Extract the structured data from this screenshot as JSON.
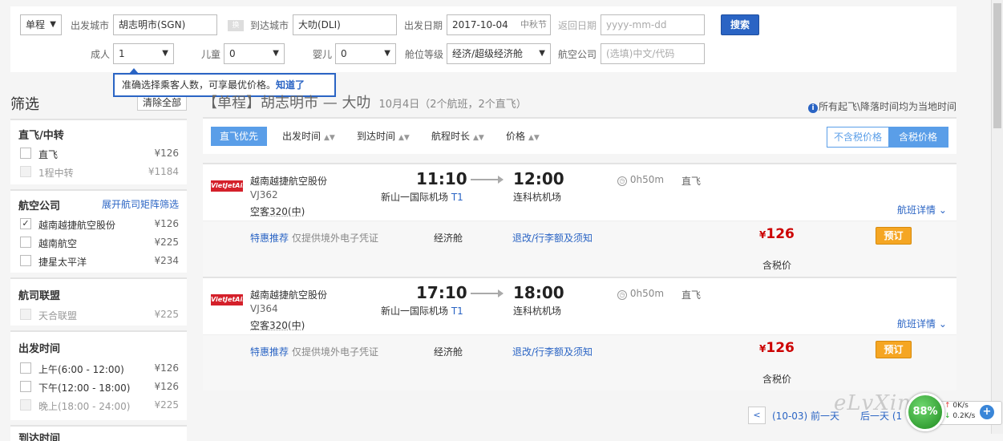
{
  "search": {
    "trip_type": "单程",
    "depart_city_label": "出发城市",
    "depart_city": "胡志明市(SGN)",
    "swap_label": "换",
    "arrive_city_label": "到达城市",
    "arrive_city": "大叻(DLI)",
    "depart_date_label": "出发日期",
    "depart_date": "2017-10-04",
    "depart_date_holiday": "中秋节",
    "return_date_label": "返回日期",
    "return_date_placeholder": "yyyy-mm-dd",
    "search_button": "搜索",
    "adult_label": "成人",
    "adult_value": "1",
    "child_label": "儿童",
    "child_value": "0",
    "infant_label": "婴儿",
    "infant_value": "0",
    "cabin_label": "舱位等级",
    "cabin_value": "经济/超级经济舱",
    "airline_label": "航空公司",
    "airline_placeholder": "(选填)中文/代码"
  },
  "tooltip": {
    "text": "准确选择乘客人数，可享最优价格。",
    "link": "知道了"
  },
  "sidebar": {
    "title": "筛选",
    "clear_all": "清除全部",
    "groups": {
      "direct": {
        "title": "直飞/中转",
        "items": [
          {
            "label": "直飞",
            "price": "¥126",
            "checked": false,
            "disabled": false
          },
          {
            "label": "1程中转",
            "price": "¥1184",
            "checked": false,
            "disabled": true
          }
        ]
      },
      "airline": {
        "title": "航空公司",
        "expand_link": "展开航司矩阵筛选",
        "items": [
          {
            "label": "越南越捷航空股份",
            "price": "¥126",
            "checked": true,
            "disabled": false
          },
          {
            "label": "越南航空",
            "price": "¥225",
            "checked": false,
            "disabled": false
          },
          {
            "label": "捷星太平洋",
            "price": "¥234",
            "checked": false,
            "disabled": false
          }
        ]
      },
      "alliance": {
        "title": "航司联盟",
        "items": [
          {
            "label": "天合联盟",
            "price": "¥225",
            "checked": false,
            "disabled": true
          }
        ]
      },
      "depart_time": {
        "title": "出发时间",
        "items": [
          {
            "label": "上午(6:00 - 12:00)",
            "price": "¥126",
            "checked": false,
            "disabled": false
          },
          {
            "label": "下午(12:00 - 18:00)",
            "price": "¥126",
            "checked": false,
            "disabled": false
          },
          {
            "label": "晚上(18:00 - 24:00)",
            "price": "¥225",
            "checked": false,
            "disabled": true
          }
        ]
      },
      "arrive_time": {
        "title": "到达时间"
      }
    }
  },
  "results": {
    "header_tag": "【单程】",
    "header_route": "胡志明市 — 大叻",
    "header_sub": "10月4日（2个航班，2个直飞）",
    "local_time_note": "所有起飞\\降落时间均为当地时间",
    "sort": {
      "direct_first": "直飞优先",
      "depart_time": "出发时间",
      "arrive_time": "到达时间",
      "duration": "航程时长",
      "price": "价格"
    },
    "tax_toggle": {
      "excl": "不含税价格",
      "incl": "含税价格"
    },
    "flights": [
      {
        "logo_text": "VietJetAir",
        "airline": "越南越捷航空股份",
        "flight_no": "VJ362",
        "aircraft": "空客320(中)",
        "depart_time": "11:10",
        "depart_airport": "新山一国际机场",
        "depart_terminal": "T1",
        "arrive_time": "12:00",
        "arrive_airport": "连科杭机场",
        "duration": "0h50m",
        "direct": "直飞",
        "detail_link": "航班详情",
        "promo": "特惠推荐",
        "promo_desc": "仅提供境外电子凭证",
        "cabin": "经济舱",
        "rules": "退改/行李额及须知",
        "price_symbol": "¥",
        "price": "126",
        "book": "预订",
        "tax_included": "含税价"
      },
      {
        "logo_text": "VietJetAir",
        "airline": "越南越捷航空股份",
        "flight_no": "VJ364",
        "aircraft": "空客320(中)",
        "depart_time": "17:10",
        "depart_airport": "新山一国际机场",
        "depart_terminal": "T1",
        "arrive_time": "18:00",
        "arrive_airport": "连科杭机场",
        "duration": "0h50m",
        "direct": "直飞",
        "detail_link": "航班详情",
        "promo": "特惠推荐",
        "promo_desc": "仅提供境外电子凭证",
        "cabin": "经济舱",
        "rules": "退改/行李额及须知",
        "price_symbol": "¥",
        "price": "126",
        "book": "预订",
        "tax_included": "含税价"
      }
    ],
    "pager": {
      "prev_arrow": "<",
      "prev_day": "(10-03) 前一天",
      "next_day": "后一天 (1"
    }
  },
  "overlay": {
    "watermark": "eLvXingn",
    "net_percent": "88%",
    "net_up": "0K/s",
    "net_down": "0.2K/s",
    "net_plus": "+"
  },
  "colors": {
    "accent_blue": "#2a64c4",
    "sort_active": "#5a9ee8",
    "price_red": "#cc0000",
    "book_orange": "#f5a623"
  }
}
